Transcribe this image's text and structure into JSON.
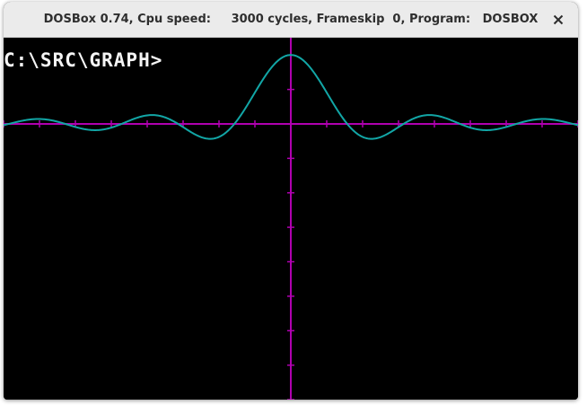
{
  "window": {
    "title": "DOSBox 0.74, Cpu speed:     3000 cycles, Frameskip  0, Program:   DOSBOX",
    "close_icon": "close-icon"
  },
  "console": {
    "prompt": "C:\\SRC\\GRAPH>"
  },
  "colors": {
    "axis": "#b000b0",
    "curve": "#12a6a6",
    "background": "#000000",
    "text": "#f4f4f4"
  },
  "chart_data": {
    "type": "line",
    "function": "sin(x)/x",
    "x_range": [
      -16,
      16
    ],
    "y_range": [
      -4,
      1.25
    ],
    "axis_ticks": {
      "x_step": 2,
      "y_step": 0.5
    }
  }
}
